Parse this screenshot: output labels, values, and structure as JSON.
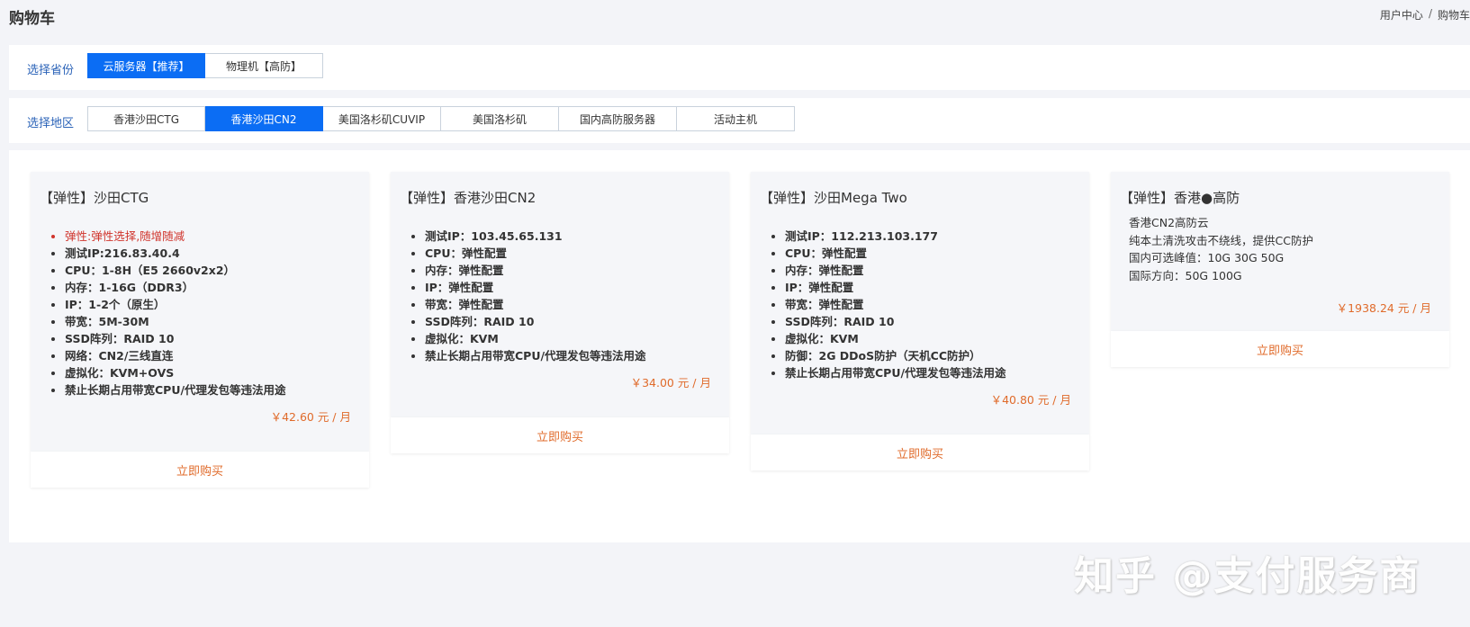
{
  "page": {
    "title": "购物车",
    "breadcrumb": [
      "用户中心",
      "/",
      "购物车"
    ]
  },
  "province_select": {
    "label": "选择省份",
    "options": [
      {
        "label": "云服务器【推荐】",
        "active": true
      },
      {
        "label": "物理机【高防】",
        "active": false
      }
    ]
  },
  "region_select": {
    "label": "选择地区",
    "options": [
      {
        "label": "香港沙田CTG",
        "active": false
      },
      {
        "label": "香港沙田CN2",
        "active": true
      },
      {
        "label": "美国洛杉矶CUVIP",
        "active": false
      },
      {
        "label": "美国洛杉矶",
        "active": false
      },
      {
        "label": "国内高防服务器",
        "active": false
      },
      {
        "label": "活动主机",
        "active": false
      }
    ]
  },
  "products": [
    {
      "title": "【弹性】沙田CTG",
      "highlight": "弹性:弹性选择,随增随减",
      "specs": [
        "测试IP:216.83.40.4",
        "CPU：1-8H（E5 2660v2x2）",
        "内存：1-16G（DDR3）",
        "IP：1-2个（原生）",
        "带宽：5M-30M",
        "SSD阵列：RAID 10",
        "网络：CN2/三线直连",
        "虚拟化：KVM+OVS",
        "禁止长期占用带宽CPU/代理发包等违法用途"
      ],
      "price": "￥42.60 元 / 月",
      "buy_label": "立即购买"
    },
    {
      "title": "【弹性】香港沙田CN2",
      "specs": [
        "测试IP：103.45.65.131",
        "CPU：弹性配置",
        "内存：弹性配置",
        "IP：弹性配置",
        "带宽：弹性配置",
        "SSD阵列：RAID 10",
        "虚拟化：KVM",
        "禁止长期占用带宽CPU/代理发包等违法用途"
      ],
      "price": "￥34.00 元 / 月",
      "buy_label": "立即购买"
    },
    {
      "title": "【弹性】沙田Mega Two",
      "specs": [
        "测试IP：112.213.103.177",
        "CPU：弹性配置",
        "内存：弹性配置",
        "IP：弹性配置",
        "带宽：弹性配置",
        "SSD阵列：RAID 10",
        "虚拟化：KVM",
        "防御：2G DDoS防护（天机CC防护）",
        "禁止长期占用带宽CPU/代理发包等违法用途"
      ],
      "price": "￥40.80 元 / 月",
      "buy_label": "立即购买"
    },
    {
      "title": "【弹性】香港●高防",
      "desc": [
        "香港CN2高防云",
        "纯本土清洗攻击不绕线，提供CC防护",
        "国内可选峰值：10G 30G 50G",
        "国际方向：50G 100G"
      ],
      "price": "￥1938.24 元 / 月",
      "buy_label": "立即购买"
    }
  ],
  "watermark": "知乎 @支付服务商",
  "colors": {
    "accent": "#0b6df4",
    "price": "#e06b2b",
    "label_blue": "#2b63b8",
    "highlight_red": "#d0342c"
  }
}
